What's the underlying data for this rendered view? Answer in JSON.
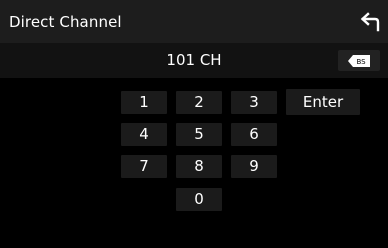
{
  "header": {
    "title": "Direct Channel",
    "back_icon": "return-arrow-icon"
  },
  "display": {
    "channel_text": "101 CH",
    "backspace_label": "BS",
    "backspace_icon": "backspace-icon"
  },
  "keypad": {
    "k1": "1",
    "k2": "2",
    "k3": "3",
    "k4": "4",
    "k5": "5",
    "k6": "6",
    "k7": "7",
    "k8": "8",
    "k9": "9",
    "k0": "0",
    "enter": "Enter"
  }
}
